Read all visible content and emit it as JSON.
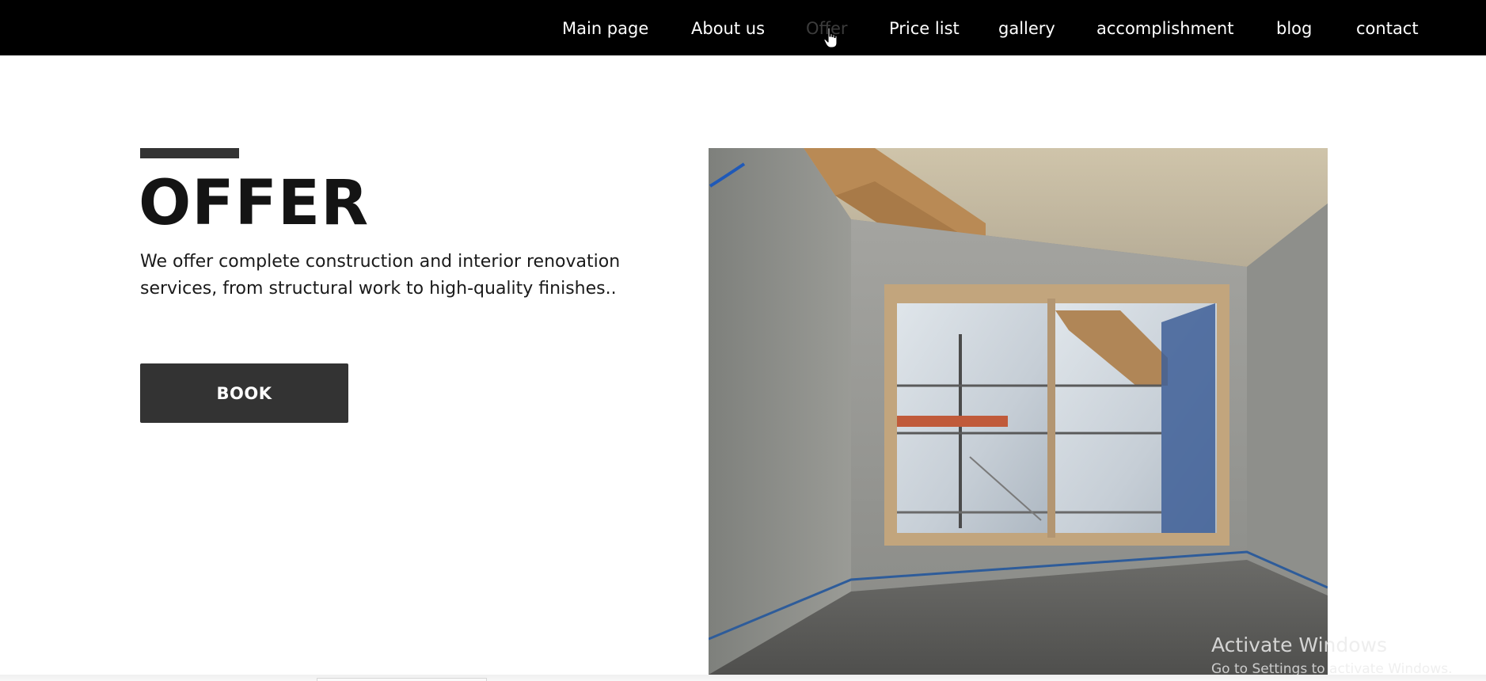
{
  "nav": {
    "items": [
      {
        "label": "Main page"
      },
      {
        "label": "About us"
      },
      {
        "label": "Offer"
      },
      {
        "label": "Price list"
      },
      {
        "label": "gallery"
      },
      {
        "label": "accomplishment"
      },
      {
        "label": "blog"
      },
      {
        "label": "contact"
      }
    ],
    "active": "Offer"
  },
  "hero": {
    "title": "OFFER",
    "description": "We offer complete construction and interior renovation services, from structural work to high-quality finishes..",
    "button_label": "BOOK",
    "image_icon": "construction-room-photo"
  },
  "watermark": {
    "title": "Activate Windows",
    "subtitle": "Go to Settings to activate Windows."
  },
  "colors": {
    "navbar_bg": "#000000",
    "nav_text": "#ffffff",
    "nav_active": "#3c3c3c",
    "accent": "#333333",
    "title": "#141414"
  }
}
